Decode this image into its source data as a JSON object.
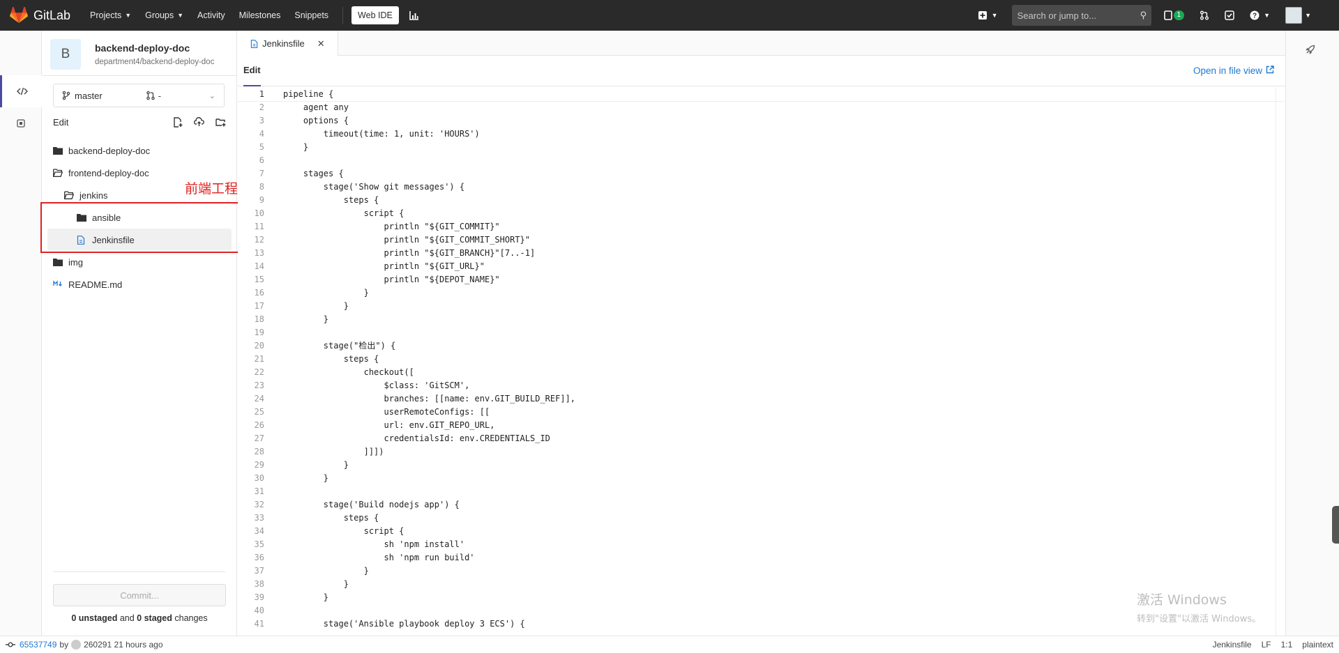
{
  "nav": {
    "brand": "GitLab",
    "projects": "Projects",
    "groups": "Groups",
    "activity": "Activity",
    "milestones": "Milestones",
    "snippets": "Snippets",
    "web_ide": "Web IDE",
    "search_placeholder": "Search or jump to...",
    "todo_count": "1",
    "brand_color": "#e24329"
  },
  "project": {
    "avatar_letter": "B",
    "name": "backend-deploy-doc",
    "path": "department4/backend-deploy-doc",
    "branch": "master",
    "mr": "-",
    "edit_label": "Edit"
  },
  "tree": [
    {
      "name": "backend-deploy-doc",
      "type": "folder",
      "depth": 0
    },
    {
      "name": "frontend-deploy-doc",
      "type": "folder-open",
      "depth": 0
    },
    {
      "name": "jenkins",
      "type": "folder-open",
      "depth": 1
    },
    {
      "name": "ansible",
      "type": "folder",
      "depth": 2
    },
    {
      "name": "Jenkinsfile",
      "type": "file",
      "depth": 2,
      "selected": true
    },
    {
      "name": "img",
      "type": "folder",
      "depth": 0
    },
    {
      "name": "README.md",
      "type": "markdown",
      "depth": 0
    }
  ],
  "annotation": "前端工程引入的文件",
  "commit": {
    "button": "Commit...",
    "unstaged_count": "0 unstaged",
    "and": " and ",
    "staged_count": "0 staged",
    "suffix": " changes"
  },
  "editor": {
    "tab": "Jenkinsfile",
    "mode": "Edit",
    "open_file_view": "Open in file view",
    "lines": [
      "pipeline {",
      "    agent any",
      "    options {",
      "        timeout(time: 1, unit: 'HOURS')",
      "    }",
      "",
      "    stages {",
      "        stage('Show git messages') {",
      "            steps {",
      "                script {",
      "                    println \"${GIT_COMMIT}\"",
      "                    println \"${GIT_COMMIT_SHORT}\"",
      "                    println \"${GIT_BRANCH}\"[7..-1]",
      "                    println \"${GIT_URL}\"",
      "                    println \"${DEPOT_NAME}\"",
      "                }",
      "            }",
      "        }",
      "",
      "        stage(\"检出\") {",
      "            steps {",
      "                checkout([",
      "                    $class: 'GitSCM',",
      "                    branches: [[name: env.GIT_BUILD_REF]],",
      "                    userRemoteConfigs: [[",
      "                    url: env.GIT_REPO_URL,",
      "                    credentialsId: env.CREDENTIALS_ID",
      "                ]]])",
      "            }",
      "        }",
      "",
      "        stage('Build nodejs app') {",
      "            steps {",
      "                script {",
      "                    sh 'npm install'",
      "                    sh 'npm run build'",
      "                }",
      "            }",
      "        }",
      "",
      "        stage('Ansible playbook deploy 3 ECS') {"
    ]
  },
  "watermark": {
    "line1": "激活 Windows",
    "line2": "转到\"设置\"以激活 Windows。"
  },
  "status": {
    "commit_hash": "65537749",
    "by": "by",
    "author_time": "260291 21 hours ago",
    "file": "Jenkinsfile",
    "eol": "LF",
    "position": "1:1",
    "language": "plaintext"
  }
}
